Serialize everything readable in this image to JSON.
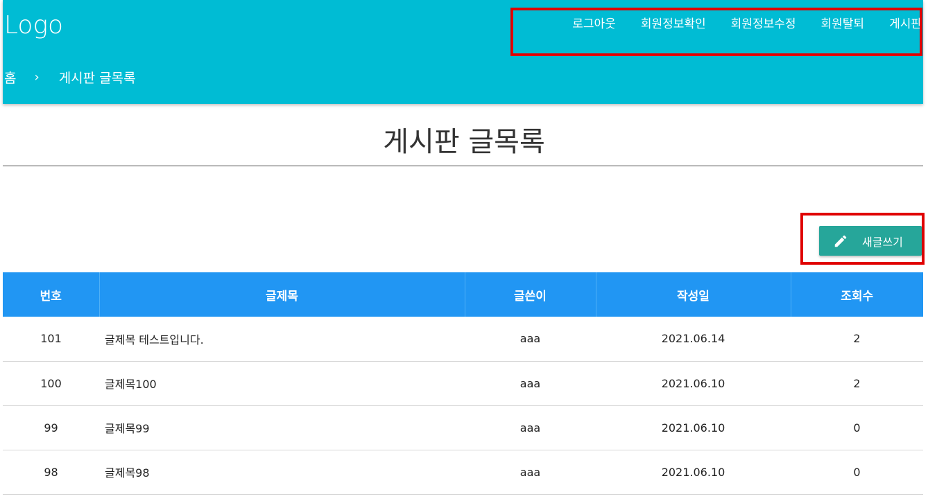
{
  "header": {
    "logo": "Logo",
    "nav": [
      "로그아웃",
      "회원정보확인",
      "회원정보수정",
      "회원탈퇴",
      "게시판"
    ],
    "breadcrumb": {
      "home": "홈",
      "separator": "›",
      "current": "게시판 글목록"
    }
  },
  "main": {
    "title": "게시판 글목록",
    "write_button": {
      "label": "새글쓰기",
      "icon": "pencil-icon"
    }
  },
  "table": {
    "headers": [
      "번호",
      "글제목",
      "글쓴이",
      "작성일",
      "조회수"
    ],
    "rows": [
      {
        "no": "101",
        "title": "글제목 테스트입니다.",
        "author": "aaa",
        "date": "2021.06.14",
        "views": "2"
      },
      {
        "no": "100",
        "title": "글제목100",
        "author": "aaa",
        "date": "2021.06.10",
        "views": "2"
      },
      {
        "no": "99",
        "title": "글제목99",
        "author": "aaa",
        "date": "2021.06.10",
        "views": "0"
      },
      {
        "no": "98",
        "title": "글제목98",
        "author": "aaa",
        "date": "2021.06.10",
        "views": "0"
      }
    ]
  },
  "colors": {
    "header_bg": "#00bcd4",
    "table_header_bg": "#2196f3",
    "button_bg": "#26a69a",
    "highlight": "#e00000"
  }
}
